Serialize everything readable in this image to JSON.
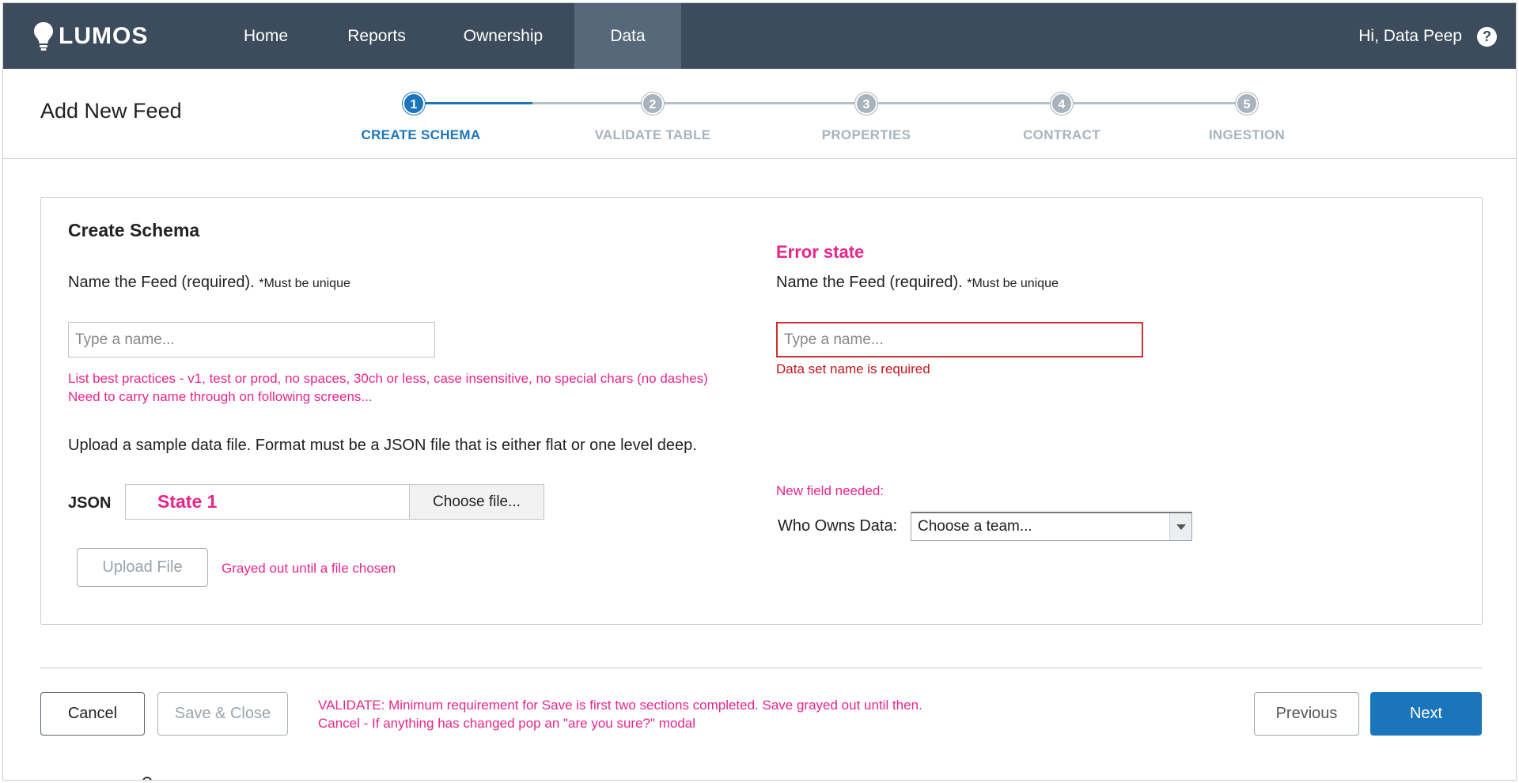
{
  "app": {
    "logo_text": "LUMOS",
    "logo_icon": "lightbulb-icon"
  },
  "nav": {
    "items": [
      {
        "label": "Home",
        "active": false
      },
      {
        "label": "Reports",
        "active": false
      },
      {
        "label": "Ownership",
        "active": false
      },
      {
        "label": "Data",
        "active": true
      }
    ],
    "greeting": "Hi, Data Peep",
    "help_icon": "?"
  },
  "header": {
    "title": "Add New Feed"
  },
  "stepper": {
    "steps": [
      {
        "number": "1",
        "label": "CREATE SCHEMA",
        "active": true
      },
      {
        "number": "2",
        "label": "VALIDATE TABLE",
        "active": false
      },
      {
        "number": "3",
        "label": "PROPERTIES",
        "active": false
      },
      {
        "number": "4",
        "label": "CONTRACT",
        "active": false
      },
      {
        "number": "5",
        "label": "INGESTION",
        "active": false
      }
    ]
  },
  "form": {
    "section_title": "Create Schema",
    "name_label": "Name the Feed (required).",
    "name_hint": "*Must be unique",
    "name_placeholder": "Type a name...",
    "notes": [
      "List best practices - v1, test or prod, no spaces, 30ch or less, case insensitive, no special chars (no dashes)",
      "Need to carry name through on following screens..."
    ],
    "upload_instructions": "Upload a sample data file. Format must be a JSON file that is either flat or one level deep.",
    "json_label": "JSON",
    "file_state": "State 1",
    "choose_file_label": "Choose file...",
    "upload_button_label": "Upload File",
    "upload_note": "Grayed out until a file chosen"
  },
  "error_state": {
    "heading": "Error state",
    "name_label": "Name the Feed (required).",
    "name_hint": "*Must be unique",
    "name_placeholder": "Type a name...",
    "error_message": "Data set name is required",
    "new_field_note": "New field needed:",
    "owner_label": "Who Owns Data:",
    "owner_select_value": "Choose a team..."
  },
  "footer": {
    "cancel_label": "Cancel",
    "save_close_label": "Save & Close",
    "notes": [
      "VALIDATE: Minimum requirement for Save is first two sections completed. Save grayed out until then.",
      "Cancel - If anything has changed pop an \"are you sure?\" modal"
    ],
    "previous_label": "Previous",
    "next_label": "Next"
  },
  "colors": {
    "nav_bg": "#3d4c5c",
    "nav_active_bg": "#56687a",
    "accent_blue": "#1b75bb",
    "annotation_pink": "#e8258a",
    "error_red": "#c4141b",
    "step_inactive": "#a8b3bd"
  }
}
